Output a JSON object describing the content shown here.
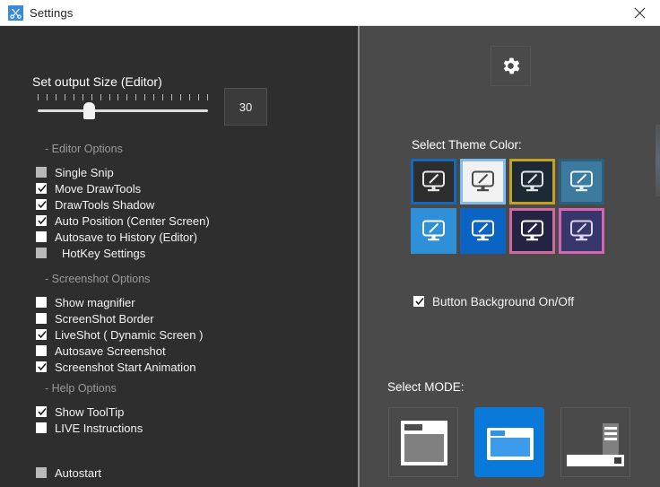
{
  "window": {
    "title": "Settings",
    "app_icon": "scissors-icon",
    "close_icon": "close-icon"
  },
  "colors": {
    "left_panel_bg": "#2e2e2e",
    "right_panel_bg": "#4a4a4a",
    "titlebar_bg": "#ffffff",
    "accent_blue": "#0a7ada",
    "divider": "#8f8f8f",
    "group_title": "#9a9a9a",
    "label_text": "#f3f3f3"
  },
  "slider": {
    "title": "Set output Size (Editor)",
    "value": "30",
    "min": 0,
    "max": 100,
    "percent": 30,
    "ticks": 20
  },
  "left_panel": {
    "groups": [
      {
        "title": "- Editor Options",
        "options": [
          {
            "label": "Single Snip",
            "checked": false,
            "disabled": true,
            "indent": false
          },
          {
            "label": "Move DrawTools",
            "checked": true,
            "disabled": false,
            "indent": false
          },
          {
            "label": "DrawTools Shadow",
            "checked": true,
            "disabled": false,
            "indent": false
          },
          {
            "label": "Auto Position (Center Screen)",
            "checked": true,
            "disabled": false,
            "indent": false
          },
          {
            "label": "Autosave to History (Editor)",
            "checked": false,
            "disabled": false,
            "indent": false
          },
          {
            "label": "HotKey Settings",
            "checked": false,
            "disabled": true,
            "indent": true
          }
        ]
      },
      {
        "title": "- Screenshot Options",
        "options": [
          {
            "label": "Show magnifier",
            "checked": false,
            "disabled": false,
            "indent": false
          },
          {
            "label": "ScreenShot Border",
            "checked": false,
            "disabled": false,
            "indent": false
          },
          {
            "label": "LiveShot ( Dynamic Screen )",
            "checked": true,
            "disabled": false,
            "indent": false
          },
          {
            "label": "Autosave Screenshot",
            "checked": false,
            "disabled": false,
            "indent": false
          },
          {
            "label": "Screenshot Start Animation",
            "checked": true,
            "disabled": false,
            "indent": false
          }
        ]
      },
      {
        "title": "- Help Options",
        "options": [
          {
            "label": "Show ToolTip",
            "checked": true,
            "disabled": false,
            "indent": false
          },
          {
            "label": "LIVE Instructions",
            "checked": false,
            "disabled": false,
            "indent": false
          }
        ]
      }
    ],
    "autostart": {
      "label": "Autostart",
      "checked": false,
      "disabled": true
    }
  },
  "right_panel": {
    "gear_icon": "gear-icon",
    "theme_label": "Select Theme Color:",
    "themes": [
      {
        "name": "dark-grey",
        "fill": "#2d2d2d",
        "border": "#1668b8",
        "monitor": "#e8e8e8",
        "selected": false
      },
      {
        "name": "light-white",
        "fill": "#f2f2f2",
        "border": "#7fbdee",
        "monitor": "#4a4a4a",
        "selected": true
      },
      {
        "name": "midnight",
        "fill": "#1d2a35",
        "border": "#c2a21e",
        "monitor": "#dfe4e8",
        "selected": false
      },
      {
        "name": "teal-blue",
        "fill": "#3c7b9d",
        "border": "#2b5f7c",
        "monitor": "#eaf2f7",
        "selected": false
      },
      {
        "name": "sky-blue",
        "fill": "#2d90d8",
        "border": "#2d90d8",
        "monitor": "#ffffff",
        "selected": false
      },
      {
        "name": "strong-blue",
        "fill": "#0b63c4",
        "border": "#0b63c4",
        "monitor": "#ffffff",
        "selected": false
      },
      {
        "name": "navy-pink",
        "fill": "#232444",
        "border": "#d2699e",
        "monitor": "#ffffff",
        "selected": false
      },
      {
        "name": "indigo-pink",
        "fill": "#37376b",
        "border": "#d464b4",
        "monitor": "#ddd6f2",
        "selected": false
      }
    ],
    "button_background": {
      "label": "Button Background On/Off",
      "checked": true
    },
    "mode_label": "Select MODE:",
    "modes": [
      {
        "name": "window-mode",
        "selected": false
      },
      {
        "name": "compact-mode",
        "selected": true
      },
      {
        "name": "taskbar-mode",
        "selected": false
      }
    ]
  }
}
